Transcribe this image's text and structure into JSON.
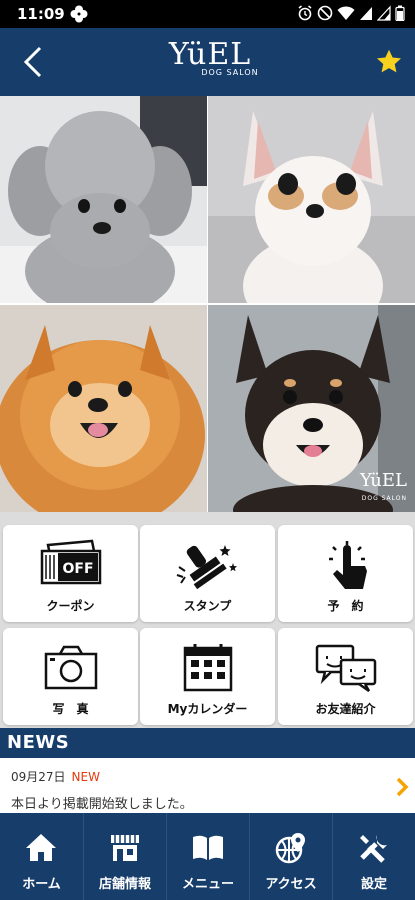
{
  "status_bar": {
    "time": "11:09",
    "icons": [
      "pinwheel-icon",
      "alarm-icon",
      "silent-icon",
      "wifi-icon",
      "signal-icon",
      "signal-icon",
      "battery-icon"
    ]
  },
  "header": {
    "logo_main": "YüEL",
    "logo_sub": "DOG SALON",
    "back_icon": "chevron-left-icon",
    "favorite_icon": "star-icon",
    "accent_color": "#173d6b",
    "star_color": "#f7d11e"
  },
  "photos": {
    "watermark_main": "YüEL",
    "watermark_sub": "DOG SALON",
    "items": [
      "grey-poodle-photo",
      "chihuahua-photo",
      "pomeranian-photo",
      "shiba-photo"
    ]
  },
  "menu": {
    "tiles": [
      {
        "label": "クーポン",
        "icon": "coupon-icon",
        "icon_text": "OFF"
      },
      {
        "label": "スタンプ",
        "icon": "stamp-icon"
      },
      {
        "label": "予　約",
        "icon": "tap-icon"
      },
      {
        "label": "写　真",
        "icon": "camera-icon"
      },
      {
        "label": "Myカレンダー",
        "icon": "calendar-icon"
      },
      {
        "label": "お友達紹介",
        "icon": "chat-bubbles-icon"
      }
    ]
  },
  "news": {
    "title": "NEWS",
    "items": [
      {
        "date": "09月27日",
        "badge": "NEW",
        "text": "本日より掲載開始致しました。"
      }
    ],
    "badge_color": "#e8380d",
    "arrow_color": "#f5a300"
  },
  "bottom_nav": {
    "items": [
      {
        "label": "ホーム",
        "icon": "home-icon"
      },
      {
        "label": "店舗情報",
        "icon": "shop-icon"
      },
      {
        "label": "メニュー",
        "icon": "book-icon"
      },
      {
        "label": "アクセス",
        "icon": "globe-pin-icon"
      },
      {
        "label": "設定",
        "icon": "tools-icon"
      }
    ]
  }
}
